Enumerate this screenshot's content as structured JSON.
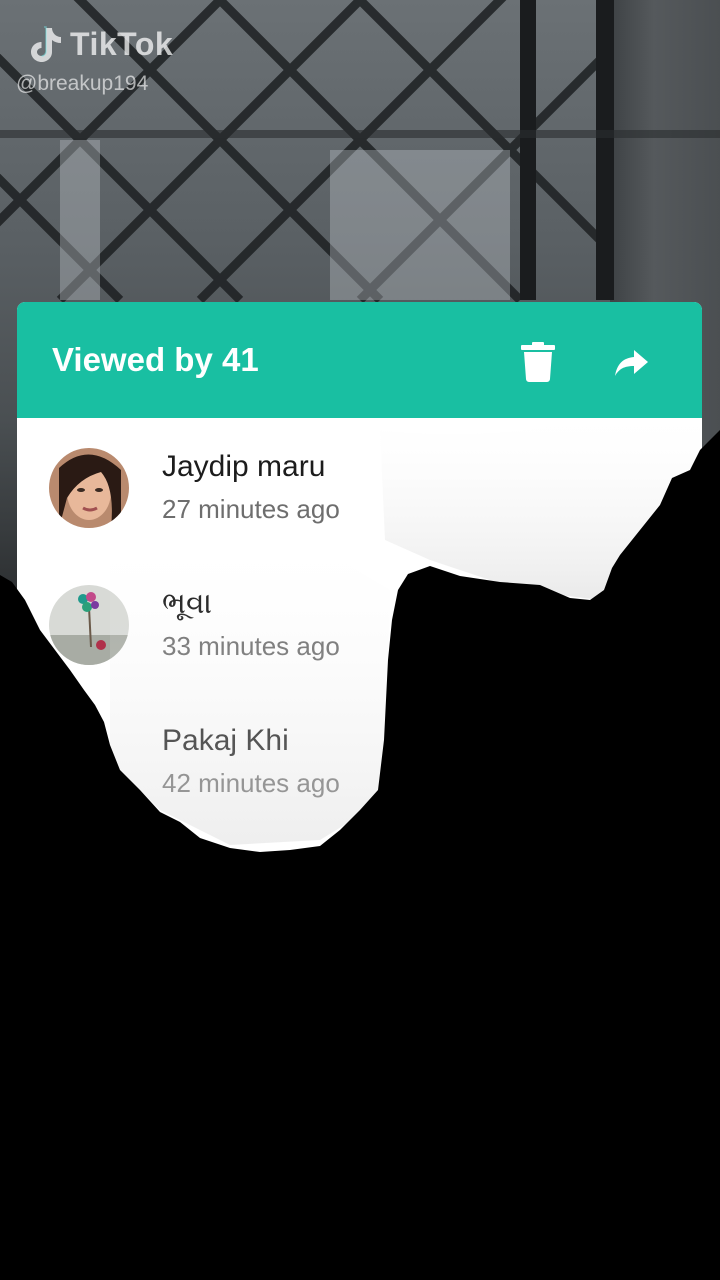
{
  "watermark": {
    "brand": "TikTok",
    "handle": "@breakup194",
    "logo_icon": "tiktok-note-icon"
  },
  "dialog": {
    "title": "Viewed by 41",
    "accent_color": "#19bfa2",
    "actions": [
      {
        "icon": "trash-icon"
      },
      {
        "icon": "share-arrow-icon"
      }
    ]
  },
  "viewers": [
    {
      "name": "Jaydip maru",
      "time": "27 minutes ago"
    },
    {
      "name": "ભૂવા",
      "time": "33 minutes ago"
    },
    {
      "name": "Pakaj Khi",
      "time": "42 minutes ago"
    }
  ]
}
